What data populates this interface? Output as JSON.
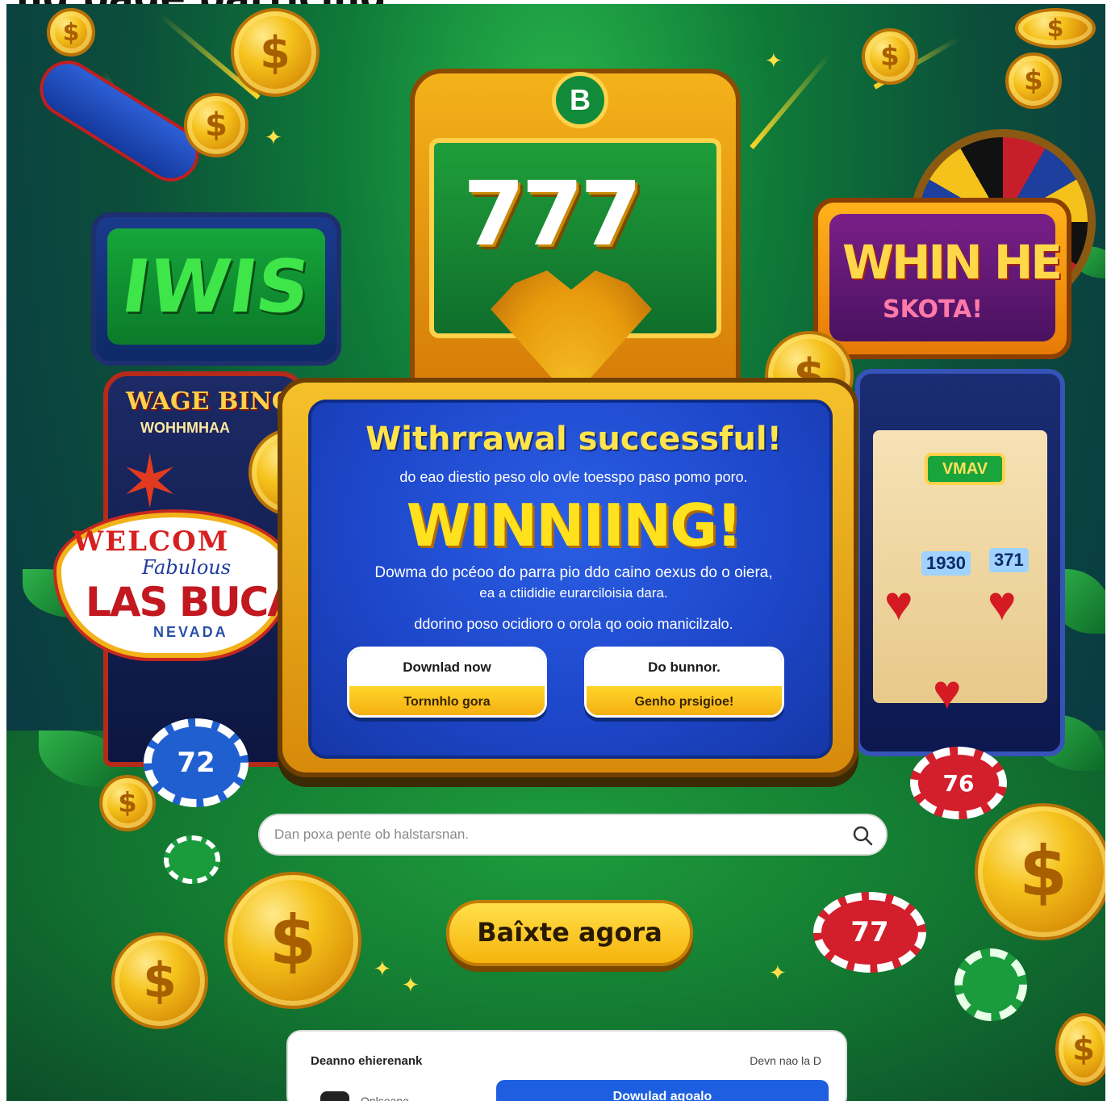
{
  "page_header": {
    "text": "ng page particing"
  },
  "scene": {
    "sign_left": {
      "text": "IWIS"
    },
    "sign_right": {
      "title": "WHIN HE",
      "subtitle": "SKOTA!"
    },
    "center_machine": {
      "badge": "B",
      "reels": "777"
    },
    "machine_left": {
      "title": "WAGE BINO",
      "subtitle": "WOHHMHAA"
    },
    "vegas_sign": {
      "welcome": "WELCOM",
      "script": "Fabulous",
      "main": "LAS BUCA",
      "state": "NEVADA"
    },
    "machine_right": {
      "reel_label": "VMAV",
      "numbers": [
        "1930",
        "371"
      ]
    },
    "chips": [
      "72",
      "76",
      "77"
    ],
    "coin_symbol": "$"
  },
  "dialog": {
    "title": "Withrrawal successful!",
    "subtitle": "do eao diestio peso olo ovle toesspo paso pomo poro.",
    "headline": "WINNIING!",
    "body_line1": "Dowma do pcéoo do parra pio ddo caino oexus do o oiera,",
    "body_line2": "ea a ctiididie eurarciloisia dara.",
    "body_line3": "ddorino poso ocidioro o orola qo ooio manicilzalo.",
    "buttons": [
      {
        "top": "Downlad now",
        "bottom": "Tornnhlo gora"
      },
      {
        "top": "Do bunnor.",
        "bottom": "Genho prsigioe!"
      }
    ]
  },
  "search": {
    "placeholder": "Dan poxa  pente ob halstarsnan."
  },
  "cta": {
    "label": "Baîxte agora"
  },
  "card": {
    "left_label": "Deanno ehierenank",
    "right_label": "Devn nao la D",
    "sub_label": "Onlsoano",
    "download_button": "Dowulad agoalo"
  },
  "colors": {
    "dialog_blue": "#1e48cc",
    "accent_yellow": "#ffe11e",
    "felt_green": "#137a31",
    "download_blue": "#1d5fe0"
  },
  "icons": [
    "search-icon",
    "coin-icon",
    "sparkle-icon"
  ]
}
